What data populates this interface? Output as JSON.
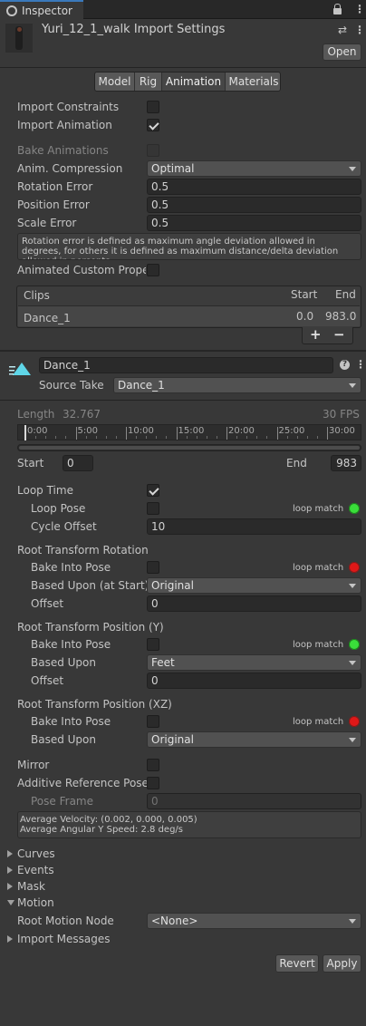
{
  "tab": {
    "title": "Inspector"
  },
  "header": {
    "title": "Yuri_12_1_walk Import Settings",
    "open_label": "Open"
  },
  "tabs": [
    "Model",
    "Rig",
    "Animation",
    "Materials"
  ],
  "import": {
    "constraints_label": "Import Constraints",
    "animation_label": "Import Animation",
    "bake_label": "Bake Animations",
    "compression_label": "Anim. Compression",
    "compression_value": "Optimal",
    "rotation_error_label": "Rotation Error",
    "rotation_error_value": "0.5",
    "position_error_label": "Position Error",
    "position_error_value": "0.5",
    "scale_error_label": "Scale Error",
    "scale_error_value": "0.5",
    "help_text": "Rotation error is defined as maximum angle deviation allowed in degrees, for others it is defined as maximum distance/delta deviation allowed in percents",
    "custom_props_label": "Animated Custom Propert"
  },
  "clips": {
    "header": "Clips",
    "start_header": "Start",
    "end_header": "End",
    "rows": [
      {
        "name": "Dance_1",
        "start": "0.0",
        "end": "983.0"
      }
    ],
    "add_label": "+",
    "remove_label": "−"
  },
  "clip": {
    "name": "Dance_1",
    "source_take_label": "Source Take",
    "source_take_value": "Dance_1",
    "length_label": "Length",
    "length_value": "32.767",
    "fps": "30 FPS",
    "timeline_ticks": [
      "0:00",
      "5:00",
      "10:00",
      "15:00",
      "20:00",
      "25:00",
      "30:00"
    ],
    "start_label": "Start",
    "start_value": "0",
    "end_label": "End",
    "end_value": "983"
  },
  "loop": {
    "loop_time_label": "Loop Time",
    "loop_pose_label": "Loop Pose",
    "loop_match": "loop match",
    "cycle_offset_label": "Cycle Offset",
    "cycle_offset_value": "10"
  },
  "rotation": {
    "header": "Root Transform Rotation",
    "bake_label": "Bake Into Pose",
    "loop_match": "loop match",
    "based_label": "Based Upon (at Start)",
    "based_value": "Original",
    "offset_label": "Offset",
    "offset_value": "0"
  },
  "pos_y": {
    "header": "Root Transform Position (Y)",
    "bake_label": "Bake Into Pose",
    "loop_match": "loop match",
    "based_label": "Based Upon",
    "based_value": "Feet",
    "offset_label": "Offset",
    "offset_value": "0"
  },
  "pos_xz": {
    "header": "Root Transform Position (XZ)",
    "bake_label": "Bake Into Pose",
    "loop_match": "loop match",
    "based_label": "Based Upon",
    "based_value": "Original"
  },
  "misc": {
    "mirror_label": "Mirror",
    "additive_label": "Additive Reference Pose",
    "pose_frame_label": "Pose Frame",
    "pose_frame_value": "0",
    "avg_velocity": "Average Velocity: (0.002, 0.000, 0.005)",
    "avg_angular": "Average Angular Y Speed: 2.8 deg/s"
  },
  "foldouts": {
    "curves": "Curves",
    "events": "Events",
    "mask": "Mask",
    "motion": "Motion",
    "root_motion_label": "Root Motion Node",
    "root_motion_value": "<None>",
    "import_messages": "Import Messages"
  },
  "footer": {
    "revert_label": "Revert",
    "apply_label": "Apply"
  },
  "colors": {
    "loop_match_ok": "#3adf3a",
    "loop_match_bad": "#e01818",
    "accent": "#5fd6e8"
  }
}
